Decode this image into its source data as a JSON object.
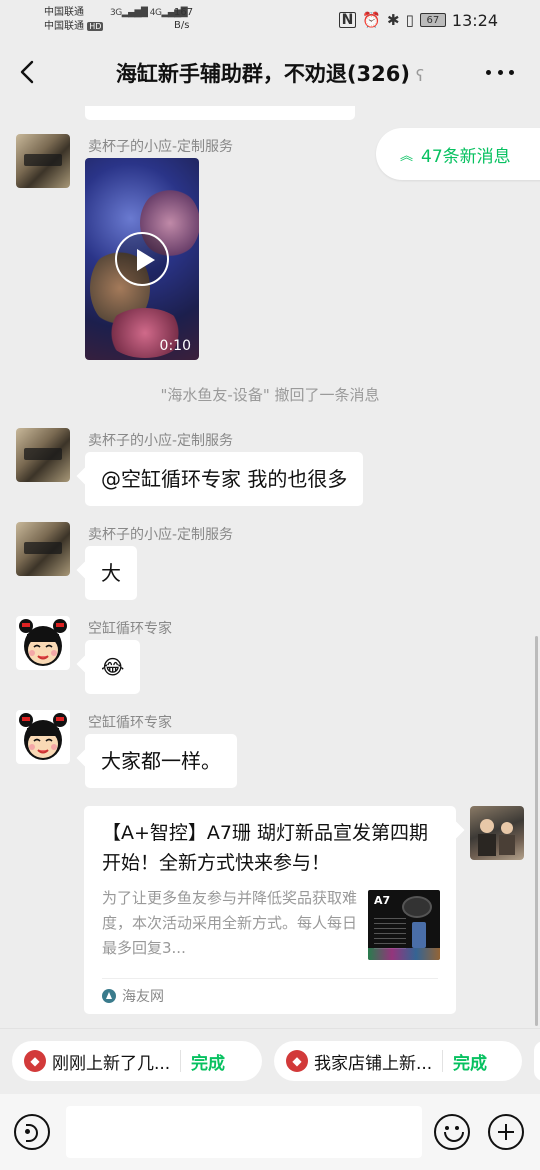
{
  "status": {
    "carrier1": "中国联通",
    "carrier2": "中国联通",
    "hd": "HD",
    "net1": "3G",
    "net2": "4G",
    "speed_value": "167",
    "speed_unit": "B/s",
    "battery": "67",
    "time": "13:24"
  },
  "header": {
    "title": "海缸新手辅助群，不劝退(326)",
    "back_icon": "chevron-left-icon",
    "more_icon": "more-dots-icon",
    "muted_icon": "ear-icon"
  },
  "new_messages": "47条新消息",
  "messages": [
    {
      "sender": "卖杯子的小应-定制服务",
      "type": "video",
      "duration": "0:10"
    },
    {
      "type": "system",
      "text": "\"海水鱼友-设备\" 撤回了一条消息"
    },
    {
      "sender": "卖杯子的小应-定制服务",
      "text": "@空缸循环专家  我的也很多"
    },
    {
      "sender": "卖杯子的小应-定制服务",
      "text": "大"
    },
    {
      "sender": "空缸循环专家",
      "text": "😂"
    },
    {
      "sender": "空缸循环专家",
      "text": "大家都一样。"
    }
  ],
  "card": {
    "title": "【A+智控】A7珊 瑚灯新品宣发第四期开始！全新方式快来参与！",
    "desc": "为了让更多鱼友参与并降低奖品获取难度，本次活动采用全新方式。每人每日最多回复3...",
    "thumb_label": "A7",
    "source": "海友网"
  },
  "chips": [
    {
      "label": "刚刚上新了几...",
      "action": "完成"
    },
    {
      "label": "我家店铺上新...",
      "action": "完成"
    }
  ],
  "input": {
    "placeholder": ""
  },
  "colors": {
    "accent": "#07c160",
    "background": "#ededed",
    "bubble": "#ffffff"
  }
}
